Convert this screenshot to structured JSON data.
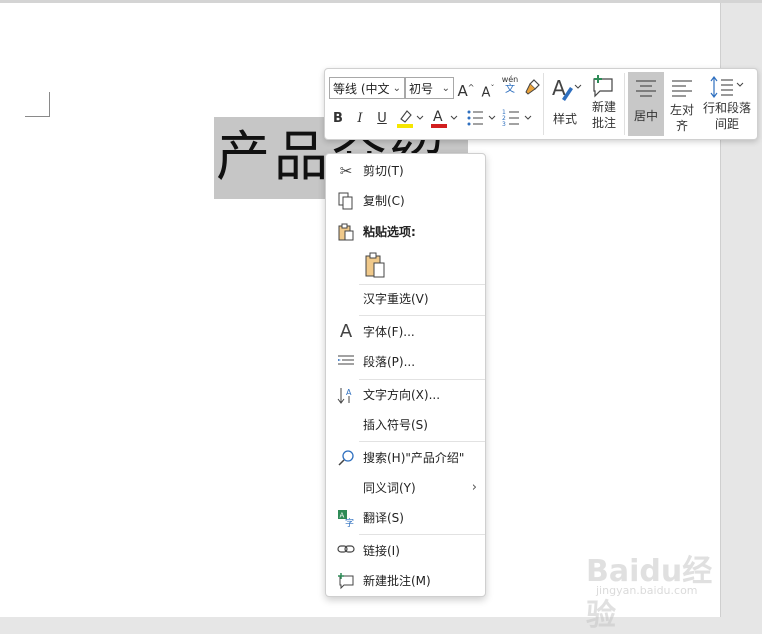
{
  "document": {
    "text": "产品介绍",
    "selection_color": "#c6c6c6"
  },
  "mini_toolbar": {
    "font_name": "等线 (中文",
    "font_size": "初号",
    "grow_font": "A",
    "shrink_font": "A",
    "phonetic_top": "wén",
    "phonetic_bottom": "文",
    "bold": "B",
    "italic": "I",
    "underline": "U",
    "font_color_letter": "A",
    "styles_label": "样式",
    "new_comment_line1": "新建",
    "new_comment_line2": "批注",
    "center_label": "居中",
    "left_align_line1": "左对",
    "left_align_line2": "齐",
    "spacing_line1": "行和段落",
    "spacing_line2": "间距"
  },
  "context_menu": {
    "cut": "剪切(T)",
    "copy": "复制(C)",
    "paste_options": "粘贴选项:",
    "reconvert": "汉字重选(V)",
    "font": "字体(F)...",
    "paragraph": "段落(P)...",
    "text_direction": "文字方向(X)...",
    "insert_symbol": "插入符号(S)",
    "search": "搜索(H)\"产品介绍\"",
    "synonyms": "同义词(Y)",
    "translate": "翻译(S)",
    "link": "链接(I)",
    "new_comment": "新建批注(M)"
  },
  "watermark": {
    "brand": "Baidu经验",
    "url": "jingyan.baidu.com"
  },
  "colors": {
    "highlight": "#f5e600",
    "font_color": "#d21e1e",
    "accent_green": "#2e8b57"
  }
}
